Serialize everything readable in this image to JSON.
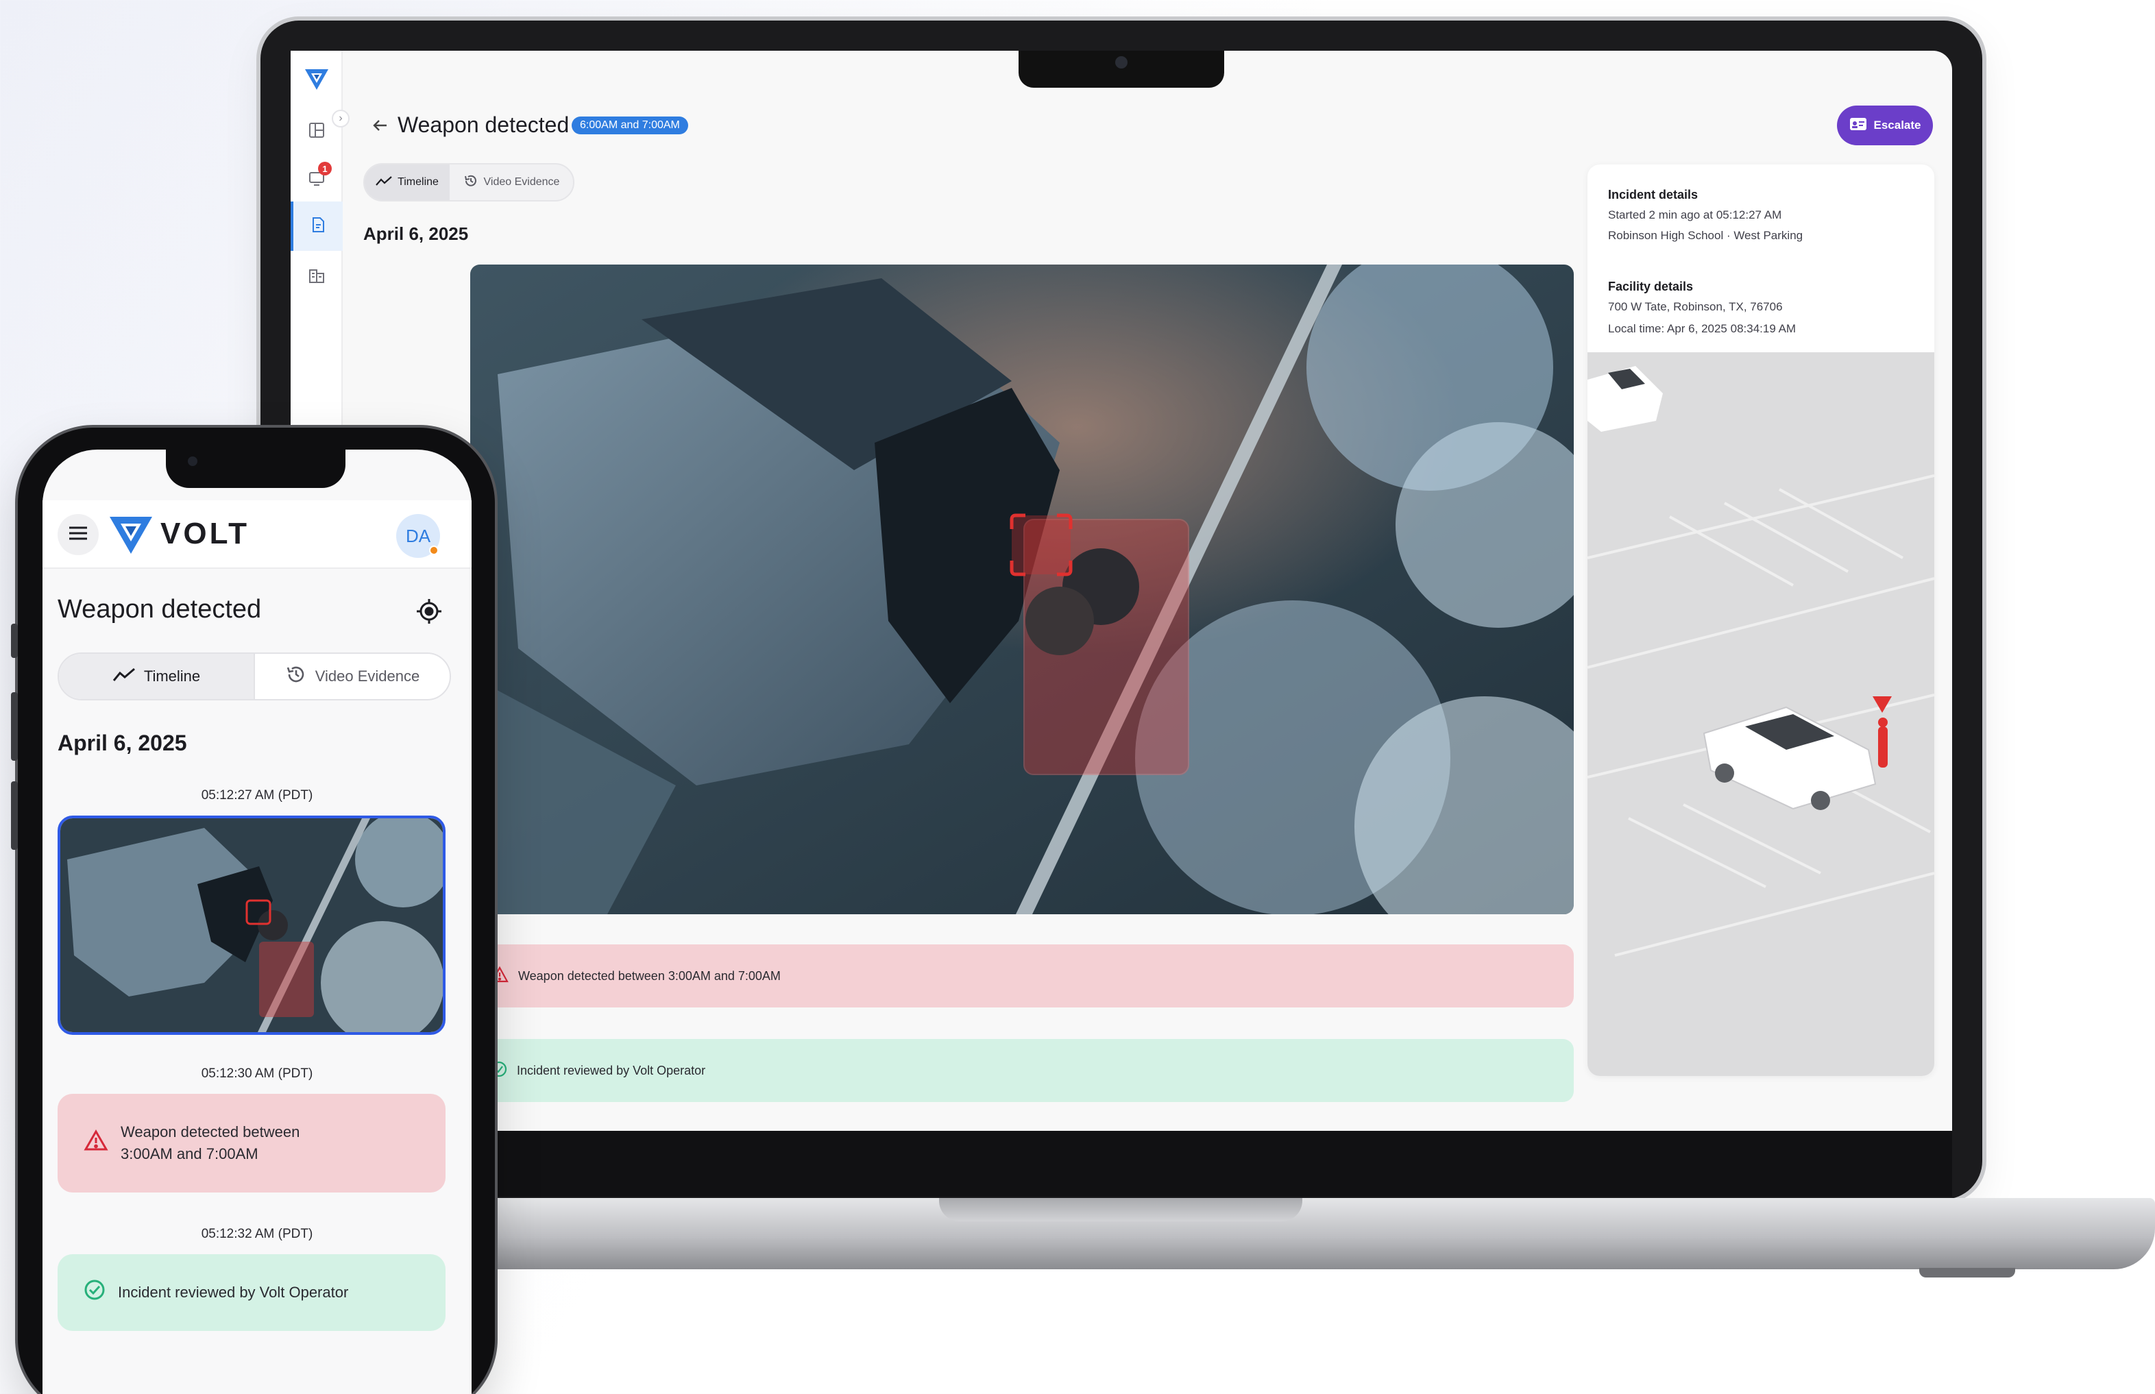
{
  "laptop": {
    "title": "Weapon detected",
    "time_badge": "6:00AM and 7:00AM",
    "escalate_label": "Escalate",
    "notification_count": "1",
    "tabs": [
      {
        "label": "Timeline",
        "icon": "trend-line-icon",
        "active": true
      },
      {
        "label": "Video Evidence",
        "icon": "history-icon",
        "active": false
      }
    ],
    "date": "April 6, 2025",
    "events": [
      {
        "type": "alert",
        "text": "Weapon detected between 3:00AM and 7:00AM",
        "color": "#f4d0d4"
      },
      {
        "type": "reviewed",
        "text": "Incident reviewed by Volt Operator",
        "color": "#d4f2e5"
      }
    ],
    "incident": {
      "heading": "Incident details",
      "started": "Started 2 min ago at 05:12:27 AM",
      "location": "Robinson High School · West Parking"
    },
    "facility": {
      "heading": "Facility details",
      "address": "700 W Tate, Robinson, TX, 76706",
      "local_time": "Local time: Apr 6, 2025 08:34:19 AM"
    }
  },
  "phone": {
    "brand": "VOLT",
    "avatar": "DA",
    "title": "Weapon detected",
    "tabs": [
      {
        "label": "Timeline",
        "icon": "trend-line-icon",
        "active": true
      },
      {
        "label": "Video Evidence",
        "icon": "history-icon",
        "active": false
      }
    ],
    "date": "April 6, 2025",
    "timeline": [
      {
        "time": "05:12:27 AM (PDT)",
        "kind": "image"
      },
      {
        "time": "05:12:30 AM (PDT)",
        "kind": "alert",
        "text": "Weapon detected between 3:00AM and 7:00AM"
      },
      {
        "time": "05:12:32 AM (PDT)",
        "kind": "reviewed",
        "text": "Incident reviewed by Volt Operator"
      }
    ]
  },
  "colors": {
    "accent_blue": "#2f7de0",
    "escalate_purple": "#6b3ec9",
    "alert_bg": "#f4d0d4",
    "alert_icon": "#d6293a",
    "success_bg": "#d4f2e5",
    "success_icon": "#27b07a",
    "detection_red": "#e0312f"
  }
}
